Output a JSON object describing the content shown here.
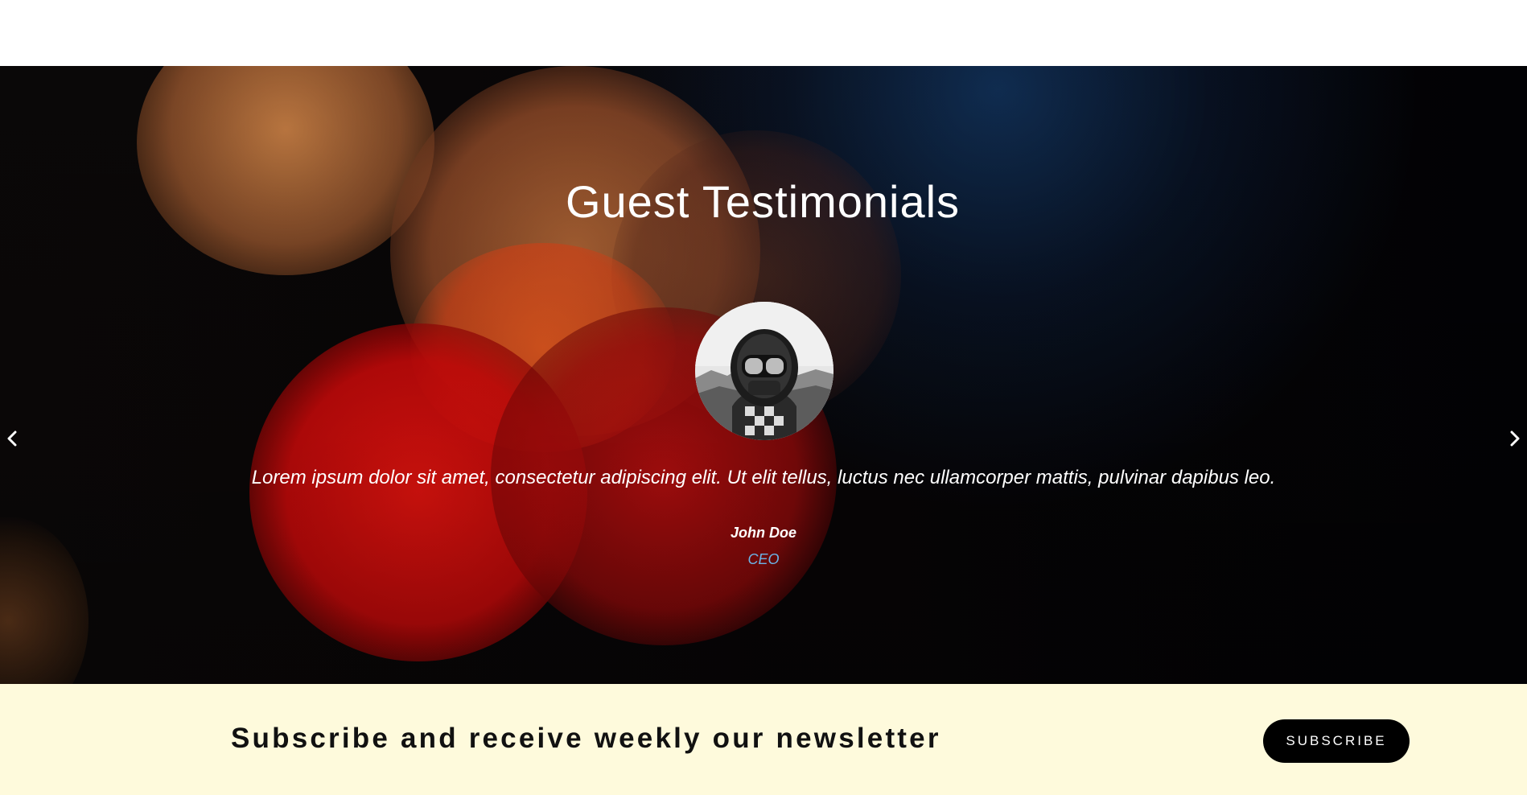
{
  "testimonials": {
    "title": "Guest Testimonials",
    "quote": "Lorem ipsum dolor sit amet, consectetur adipiscing elit. Ut elit tellus, luctus nec ullamcorper mattis, pulvinar dapibus leo.",
    "author_name": "John Doe",
    "author_role": "CEO",
    "prev_icon": "chevron-left-icon",
    "next_icon": "chevron-right-icon",
    "role_color": "#6bb3e6"
  },
  "newsletter": {
    "text": "Subscribe and receive weekly our newsletter",
    "button_label": "SUBSCRIBE",
    "background": "#fefadc"
  }
}
